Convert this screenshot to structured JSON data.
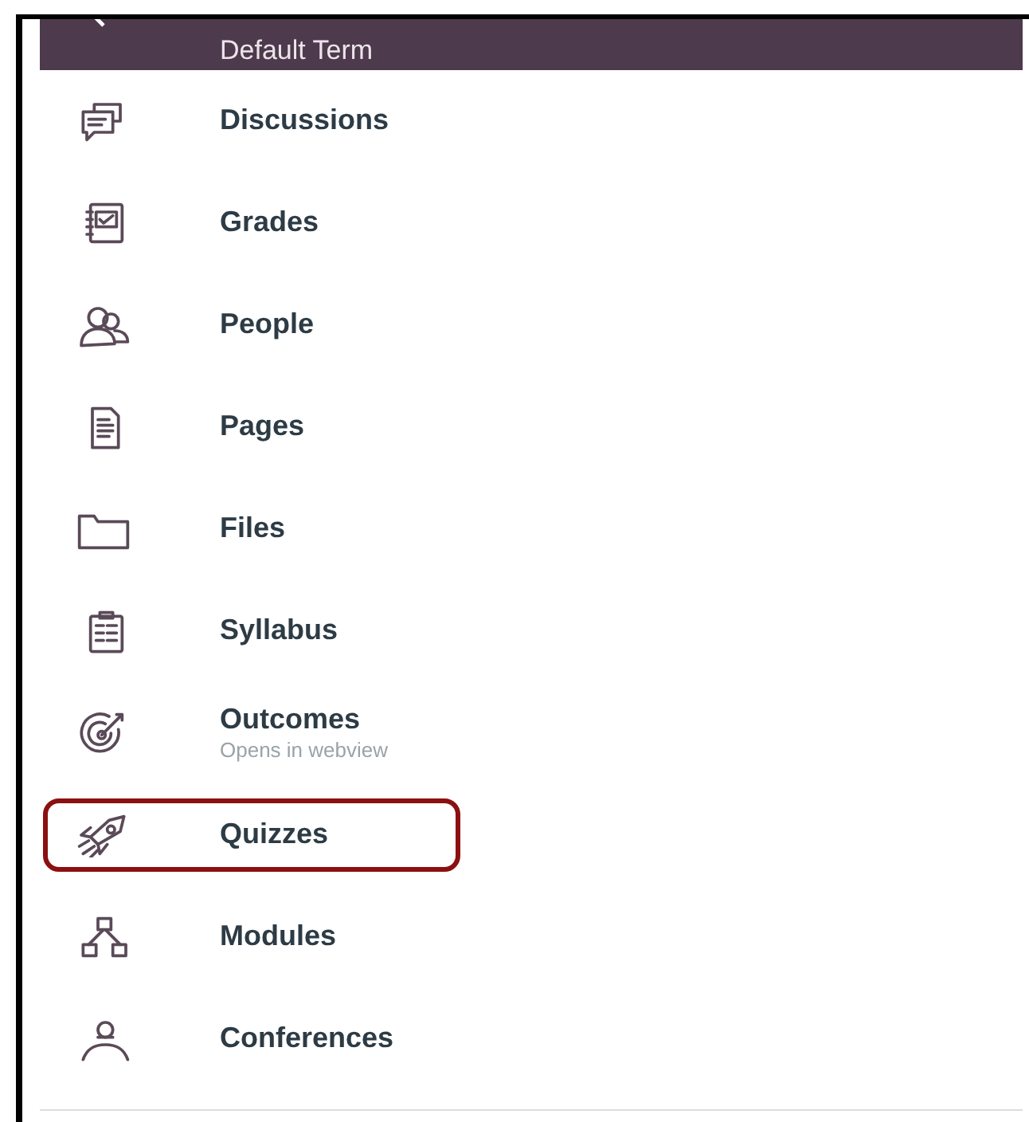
{
  "header": {
    "title": "Default Term"
  },
  "items": [
    {
      "label": "Discussions",
      "highlighted": false
    },
    {
      "label": "Grades",
      "highlighted": false
    },
    {
      "label": "People",
      "highlighted": false
    },
    {
      "label": "Pages",
      "highlighted": false
    },
    {
      "label": "Files",
      "highlighted": false
    },
    {
      "label": "Syllabus",
      "highlighted": false
    },
    {
      "label": "Outcomes",
      "subtitle": "Opens in webview",
      "highlighted": false
    },
    {
      "label": "Quizzes",
      "highlighted": true
    },
    {
      "label": "Modules",
      "highlighted": false
    },
    {
      "label": "Conferences",
      "highlighted": false
    }
  ]
}
